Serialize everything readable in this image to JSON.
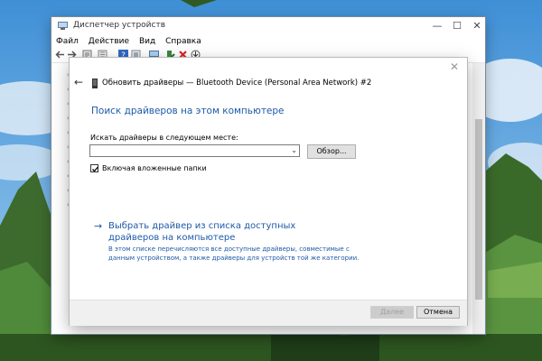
{
  "device_manager": {
    "title": "Диспетчер устройств",
    "menu": [
      "Файл",
      "Действие",
      "Вид",
      "Справка"
    ],
    "window_controls": {
      "minimize": "—",
      "maximize": "☐",
      "close": "✕"
    }
  },
  "dialog": {
    "header_title": "Обновить драйверы — Bluetooth Device (Personal Area Network) #2",
    "heading": "Поиск драйверов на этом компьютере",
    "path_label": "Искать драйверы в следующем месте:",
    "path_value": "",
    "browse_label": "Обзор...",
    "include_subfolders_label": "Включая вложенные папки",
    "include_subfolders_checked": true,
    "pick_link": "Выбрать драйвер из списка доступных драйверов на компьютере",
    "pick_desc": "В этом списке перечисляются все доступные драйверы, совместимые с данным устройством, а также драйверы для устройств той же категории.",
    "next_label": "Далее",
    "cancel_label": "Отмена"
  },
  "colors": {
    "accent": "#1e5aa8",
    "dialog_bg": "#ffffff",
    "footer_bg": "#f0f0f0"
  }
}
